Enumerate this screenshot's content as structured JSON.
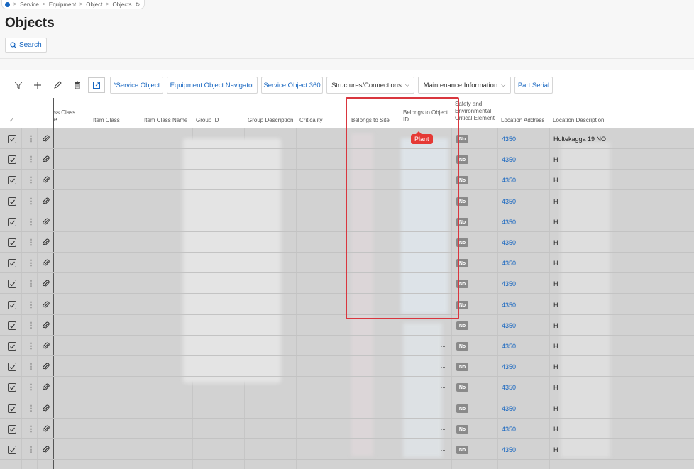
{
  "breadcrumb": [
    "Service",
    "Equipment",
    "Object",
    "Objects"
  ],
  "page": {
    "title": "Objects",
    "search_label": "Search"
  },
  "toolbar": {
    "buttons": [
      {
        "label": "*Service Object",
        "dropdown": false
      },
      {
        "label": "Equipment Object Navigator",
        "dropdown": false
      },
      {
        "label": "Service Object 360",
        "dropdown": false
      },
      {
        "label": "Structures/Connections",
        "dropdown": true
      },
      {
        "label": "Maintenance Information",
        "dropdown": true
      },
      {
        "label": "Part Serial",
        "dropdown": false
      }
    ],
    "icons": [
      "filter-icon",
      "add-icon",
      "edit-icon",
      "delete-icon",
      "open-external-icon"
    ]
  },
  "columns": {
    "class_partial": [
      "ss Class",
      "e"
    ],
    "item_class": "Item Class",
    "item_class_name": "Item Class Name",
    "group_id": "Group ID",
    "group_description": "Group Description",
    "criticality": "Criticality",
    "belongs_to_site": "Belongs to Site",
    "belongs_to_object_id": [
      "Belongs to Object",
      "ID"
    ],
    "safety": [
      "Safety and",
      "Environmental",
      "Critical Element"
    ],
    "location_address": "Location Address",
    "location_description": "Location Description"
  },
  "rows": [
    {
      "safety": "No",
      "location_address": "4350",
      "location_description": "Holtekagga 19 NO"
    },
    {
      "safety": "No",
      "location_address": "4350",
      "location_description": "H"
    },
    {
      "safety": "No",
      "location_address": "4350",
      "location_description": "H"
    },
    {
      "safety": "No",
      "location_address": "4350",
      "location_description": "H"
    },
    {
      "safety": "No",
      "location_address": "4350",
      "location_description": "H"
    },
    {
      "safety": "No",
      "location_address": "4350",
      "location_description": "H"
    },
    {
      "safety": "No",
      "location_address": "4350",
      "location_description": "H"
    },
    {
      "safety": "No",
      "location_address": "4350",
      "location_description": "H"
    },
    {
      "safety": "No",
      "location_address": "4350",
      "location_description": "H"
    },
    {
      "safety": "No",
      "location_address": "4350",
      "location_description": "H"
    },
    {
      "safety": "No",
      "location_address": "4350",
      "location_description": "H"
    },
    {
      "safety": "No",
      "location_address": "4350",
      "location_description": "H"
    },
    {
      "safety": "No",
      "location_address": "4350",
      "location_description": "H"
    },
    {
      "safety": "No",
      "location_address": "4350",
      "location_description": "H"
    },
    {
      "safety": "No",
      "location_address": "4350",
      "location_description": "H"
    },
    {
      "safety": "No",
      "location_address": "4350",
      "location_description": "H"
    }
  ],
  "annotation": {
    "tag_label": "Plant",
    "highlight_color": "#d9363e"
  },
  "colors": {
    "link": "#1565c0",
    "badge": "#8a8a8a",
    "grid_bg": "#d2d2d2"
  }
}
